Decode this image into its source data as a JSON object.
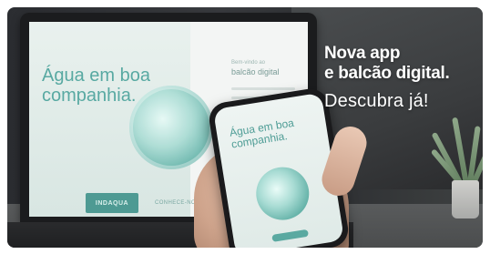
{
  "banner": {
    "headline_line1": "Nova app",
    "headline_line2": "e balcão digital.",
    "cta": "Descubra já!"
  },
  "laptop_screen": {
    "headline": "Água em boa companhia.",
    "brand": "INDAQUA",
    "small_text": "CONHECE-NOS",
    "right_subtitle": "Bem-vindo ao",
    "right_title": "balcão digital"
  },
  "phone_screen": {
    "headline": "Água em boa companhia."
  },
  "colors": {
    "brand_teal": "#58a9a2",
    "headline_white": "#ffffff"
  }
}
